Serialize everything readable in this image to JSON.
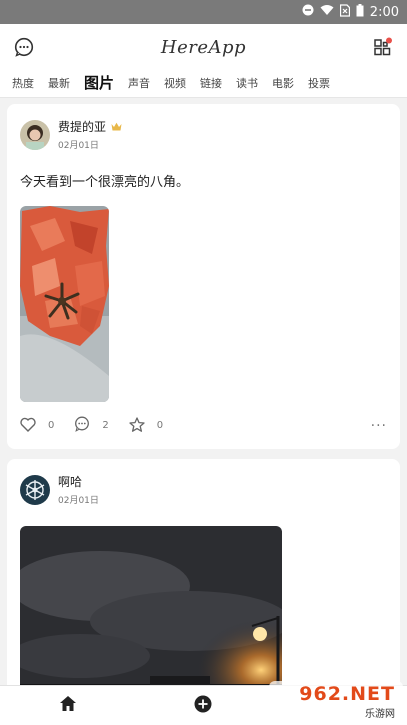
{
  "status": {
    "time": "2:00"
  },
  "header": {
    "logo": "HereApp"
  },
  "tabs": [
    "热度",
    "最新",
    "图片",
    "声音",
    "视频",
    "链接",
    "读书",
    "电影",
    "投票"
  ],
  "active_tab_index": 2,
  "posts": [
    {
      "user": "费提的亚",
      "date": "02月01日",
      "text": "今天看到一个很漂亮的八角。",
      "likes": "0",
      "comments": "2",
      "stars": "0"
    },
    {
      "user": "啊哈",
      "date": "02月01日"
    }
  ],
  "watermark": {
    "big": "962.NET",
    "small": "乐游网"
  },
  "colors": {
    "accent": "#e24a1a",
    "badge": "#e8504a",
    "crown": "#e8b84a"
  }
}
